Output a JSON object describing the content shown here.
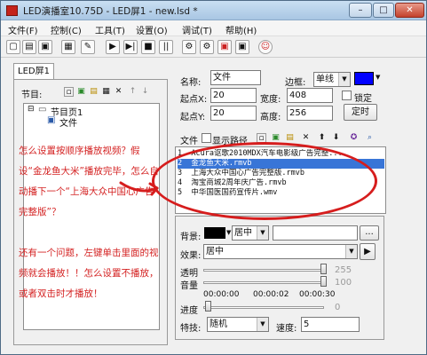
{
  "window": {
    "title": "LED演播室10.75D - LED屏1 - new.lsd *",
    "buttons": {
      "minimize": "–",
      "maximize": "□",
      "close": "✕"
    }
  },
  "menu": [
    "文件(F)",
    "控制(C)",
    "工具(T)",
    "设置(O)",
    "调试(T)",
    "帮助(H)"
  ],
  "toolbar": {
    "icons": [
      "new-icon",
      "open-icon",
      "save-icon",
      "edit-icon",
      "tool-icon",
      "play-icon",
      "step-icon",
      "stop-icon",
      "pause-icon",
      "screen-send-icon",
      "screen-check-icon",
      "screen-red-icon",
      "screen-set-icon",
      "help-face-icon"
    ],
    "glyphs": [
      "▢",
      "▤",
      "▣",
      "▦",
      "✎",
      "▶",
      "▶|",
      "■",
      "||",
      "⚙",
      "⚙",
      "▣",
      "▣",
      "☺"
    ]
  },
  "tabs": {
    "led_screen": "LED屏1"
  },
  "left": {
    "program_label": "节目:",
    "tree": {
      "root": "节目页1",
      "child": "文件"
    },
    "annotation": "怎么设置按顺序播放视频？假设“金龙鱼大米”播放完毕，怎么自动播下一个“上海大众中国心广告完整版”？\n\n还有一个问题，左键单击里面的视频就会播放！！怎么设置不播放，或者双击时才播放！"
  },
  "right": {
    "name_label": "名称:",
    "name_value": "文件",
    "border_label": "边框:",
    "border_value": "单线",
    "origin_x_label": "起点X:",
    "origin_x_value": "20",
    "width_label": "宽度:",
    "width_value": "408",
    "lock_label": "锁定",
    "origin_y_label": "起点Y:",
    "origin_y_value": "20",
    "height_label": "高度:",
    "height_value": "256",
    "locate_button": "定时",
    "file_label": "文件",
    "show_path_label": "显示路径"
  },
  "files": [
    {
      "index": "1",
      "name": "Acura讴歌2010MDX汽车电影级广告完整..."
    },
    {
      "index": "2",
      "name": "金龙鱼大米.rmvb"
    },
    {
      "index": "3",
      "name": "上海大众中国心广告完整版.rmvb"
    },
    {
      "index": "4",
      "name": "淘宝商城2周年庆广告.rmvb"
    },
    {
      "index": "5",
      "name": "中华国医国药宣传片.wmv"
    }
  ],
  "props": {
    "background_label": "背景:",
    "background_align": "居中",
    "effect_label": "效果:",
    "effect_value": "居中",
    "transparency_label": "透明",
    "transparency_value": "255",
    "volume_label": "音量",
    "volume_value": "100",
    "time_start": "00:00:00",
    "time_mid": "00:00:02",
    "time_end": "00:00:30",
    "progress_label": "进度",
    "progress_value": "0",
    "effect2_label": "特技:",
    "effect2_value": "随机",
    "speed_label": "速度:",
    "speed_value": "5",
    "ellipsis": "...",
    "play_glyph": "▶"
  },
  "colors": {
    "border_color": "#0000ff",
    "bg_color": "#000000",
    "annotation": "#d42222",
    "selection": "#3875d7"
  }
}
